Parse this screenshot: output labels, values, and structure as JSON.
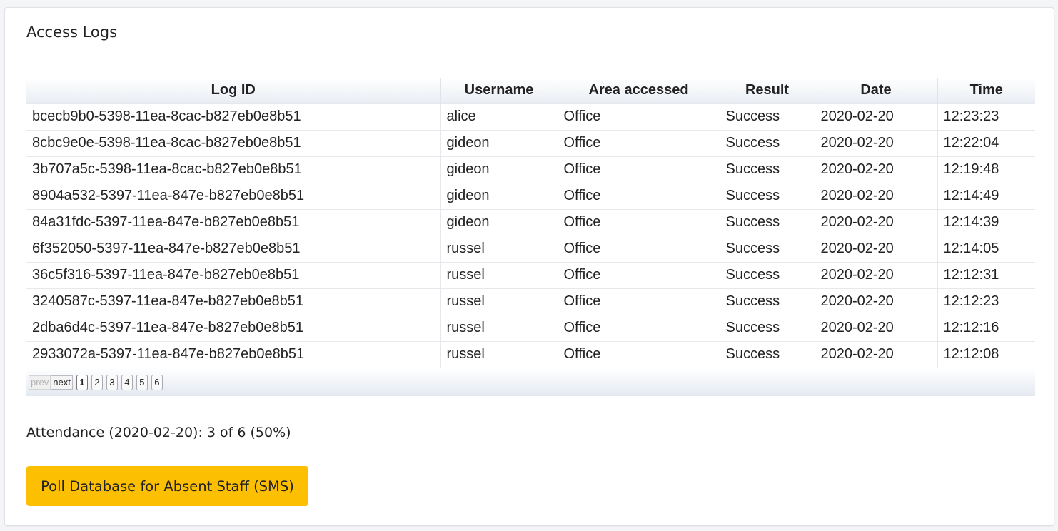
{
  "card": {
    "title": "Access Logs"
  },
  "table": {
    "headers": [
      "Log ID",
      "Username",
      "Area accessed",
      "Result",
      "Date",
      "Time"
    ],
    "rows": [
      [
        "bcecb9b0-5398-11ea-8cac-b827eb0e8b51",
        "alice",
        "Office",
        "Success",
        "2020-02-20",
        "12:23:23"
      ],
      [
        "8cbc9e0e-5398-11ea-8cac-b827eb0e8b51",
        "gideon",
        "Office",
        "Success",
        "2020-02-20",
        "12:22:04"
      ],
      [
        "3b707a5c-5398-11ea-8cac-b827eb0e8b51",
        "gideon",
        "Office",
        "Success",
        "2020-02-20",
        "12:19:48"
      ],
      [
        "8904a532-5397-11ea-847e-b827eb0e8b51",
        "gideon",
        "Office",
        "Success",
        "2020-02-20",
        "12:14:49"
      ],
      [
        "84a31fdc-5397-11ea-847e-b827eb0e8b51",
        "gideon",
        "Office",
        "Success",
        "2020-02-20",
        "12:14:39"
      ],
      [
        "6f352050-5397-11ea-847e-b827eb0e8b51",
        "russel",
        "Office",
        "Success",
        "2020-02-20",
        "12:14:05"
      ],
      [
        "36c5f316-5397-11ea-847e-b827eb0e8b51",
        "russel",
        "Office",
        "Success",
        "2020-02-20",
        "12:12:31"
      ],
      [
        "3240587c-5397-11ea-847e-b827eb0e8b51",
        "russel",
        "Office",
        "Success",
        "2020-02-20",
        "12:12:23"
      ],
      [
        "2dba6d4c-5397-11ea-847e-b827eb0e8b51",
        "russel",
        "Office",
        "Success",
        "2020-02-20",
        "12:12:16"
      ],
      [
        "2933072a-5397-11ea-847e-b827eb0e8b51",
        "russel",
        "Office",
        "Success",
        "2020-02-20",
        "12:12:08"
      ]
    ]
  },
  "pager": {
    "prev_label": "prev",
    "next_label": "next",
    "pages": [
      "1",
      "2",
      "3",
      "4",
      "5",
      "6"
    ],
    "current_page": "1"
  },
  "attendance": {
    "text": "Attendance (2020-02-20): 3 of 6 (50%)"
  },
  "poll_button": {
    "label": "Poll Database for Absent Staff (SMS)",
    "color": "#fcbf02"
  }
}
